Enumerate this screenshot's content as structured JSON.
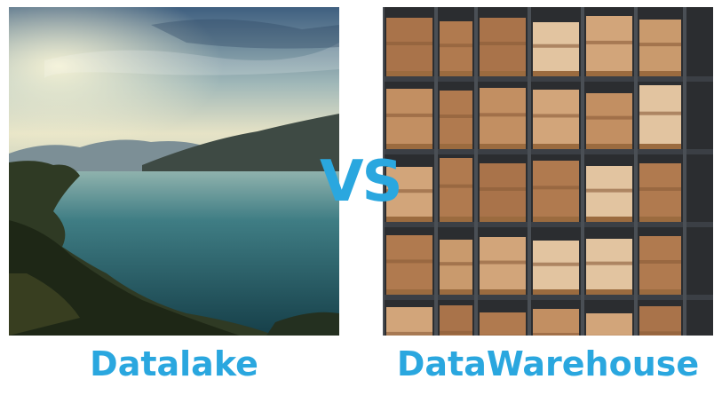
{
  "captions": {
    "left": "Datalake",
    "right": "DataWarehouse",
    "vs": "VS"
  },
  "colors": {
    "accent": "#2aa7df",
    "sky_top": "#3d5a78",
    "sky_horizon": "#e8e6cf",
    "water": "#1f5a64",
    "shelf": "#3b3f45",
    "box": "#b9855a"
  }
}
